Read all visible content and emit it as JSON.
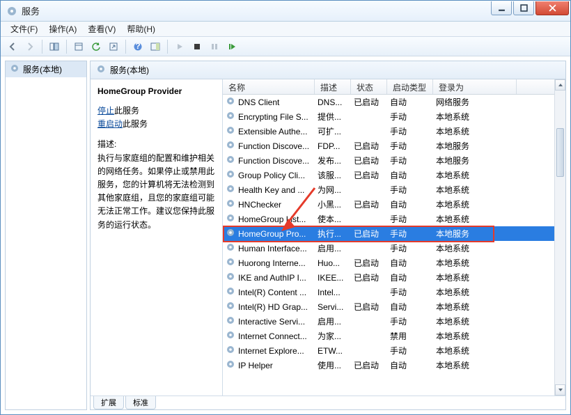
{
  "window": {
    "title": "服务"
  },
  "menu": {
    "file": "文件(F)",
    "action": "操作(A)",
    "view": "查看(V)",
    "help": "帮助(H)"
  },
  "tree": {
    "root": "服务(本地)"
  },
  "header": {
    "title": "服务(本地)"
  },
  "desc": {
    "name": "HomeGroup Provider",
    "stop_link": "停止",
    "stop_suffix": "此服务",
    "restart_link": "重启动",
    "restart_suffix": "此服务",
    "label": "描述:",
    "text": "执行与家庭组的配置和维护相关的网络任务。如果停止或禁用此服务，您的计算机将无法检测到其他家庭组，且您的家庭组可能无法正常工作。建议您保持此服务的运行状态。"
  },
  "columns": {
    "name": "名称",
    "desc": "描述",
    "status": "状态",
    "start": "启动类型",
    "logon": "登录为"
  },
  "rows": [
    {
      "name": "DNS Client",
      "desc": "DNS...",
      "status": "已启动",
      "start": "自动",
      "logon": "网络服务"
    },
    {
      "name": "Encrypting File S...",
      "desc": "提供...",
      "status": "",
      "start": "手动",
      "logon": "本地系统"
    },
    {
      "name": "Extensible Authe...",
      "desc": "可扩...",
      "status": "",
      "start": "手动",
      "logon": "本地系统"
    },
    {
      "name": "Function Discove...",
      "desc": "FDP...",
      "status": "已启动",
      "start": "手动",
      "logon": "本地服务"
    },
    {
      "name": "Function Discove...",
      "desc": "发布...",
      "status": "已启动",
      "start": "手动",
      "logon": "本地服务"
    },
    {
      "name": "Group Policy Cli...",
      "desc": "该服...",
      "status": "已启动",
      "start": "自动",
      "logon": "本地系统"
    },
    {
      "name": "Health Key and ...",
      "desc": "为网...",
      "status": "",
      "start": "手动",
      "logon": "本地系统"
    },
    {
      "name": "HNChecker",
      "desc": "小黑...",
      "status": "已启动",
      "start": "自动",
      "logon": "本地系统"
    },
    {
      "name": "HomeGroup List...",
      "desc": "使本...",
      "status": "",
      "start": "手动",
      "logon": "本地系统"
    },
    {
      "name": "HomeGroup Pro...",
      "desc": "执行...",
      "status": "已启动",
      "start": "手动",
      "logon": "本地服务",
      "selected": true
    },
    {
      "name": "Human Interface...",
      "desc": "启用...",
      "status": "",
      "start": "手动",
      "logon": "本地系统"
    },
    {
      "name": "Huorong Interne...",
      "desc": "Huo...",
      "status": "已启动",
      "start": "自动",
      "logon": "本地系统"
    },
    {
      "name": "IKE and AuthIP I...",
      "desc": "IKEE...",
      "status": "已启动",
      "start": "自动",
      "logon": "本地系统"
    },
    {
      "name": "Intel(R) Content ...",
      "desc": "Intel...",
      "status": "",
      "start": "手动",
      "logon": "本地系统"
    },
    {
      "name": "Intel(R) HD Grap...",
      "desc": "Servi...",
      "status": "已启动",
      "start": "自动",
      "logon": "本地系统"
    },
    {
      "name": "Interactive Servi...",
      "desc": "启用...",
      "status": "",
      "start": "手动",
      "logon": "本地系统"
    },
    {
      "name": "Internet Connect...",
      "desc": "为家...",
      "status": "",
      "start": "禁用",
      "logon": "本地系统"
    },
    {
      "name": "Internet Explore...",
      "desc": "ETW...",
      "status": "",
      "start": "手动",
      "logon": "本地系统"
    },
    {
      "name": "IP Helper",
      "desc": "使用...",
      "status": "已启动",
      "start": "自动",
      "logon": "本地系统"
    }
  ],
  "tabs": {
    "extended": "扩展",
    "standard": "标准"
  }
}
